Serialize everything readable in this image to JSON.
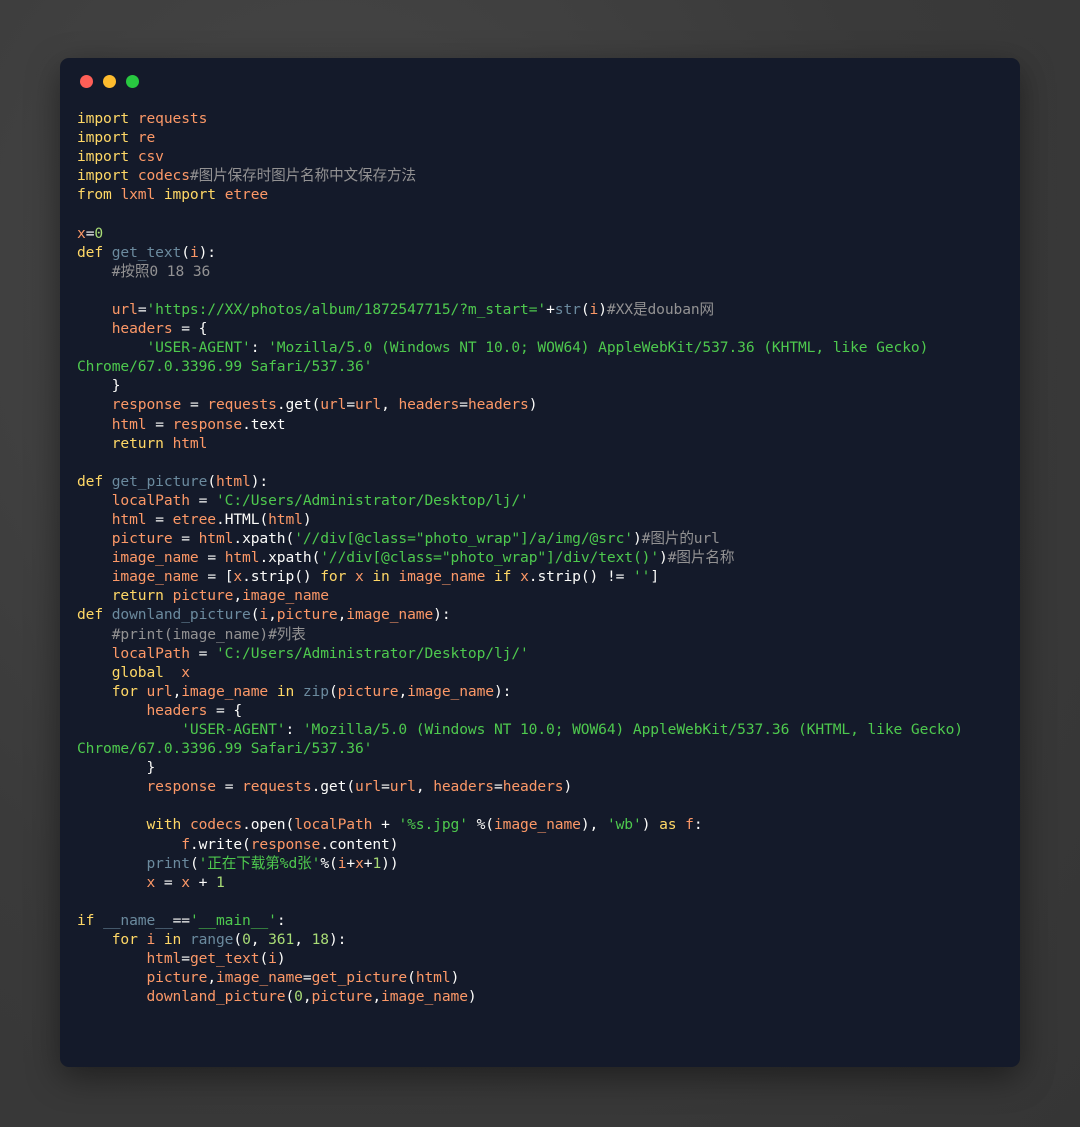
{
  "window": {
    "dots": [
      {
        "name": "close",
        "color": "#ff5f57"
      },
      {
        "name": "minimize",
        "color": "#febc2e"
      },
      {
        "name": "maximize",
        "color": "#28c840"
      }
    ]
  },
  "editor": {
    "language": "python",
    "background": "#141a2a",
    "page_background": "#3c3c3c",
    "palette": {
      "keyword": "#ffd866",
      "function": "#6b8a9e",
      "variable": "#fc9867",
      "string": "#4ec94e",
      "number": "#ab9df2",
      "comment": "#939293",
      "plain": "#fcfcfa"
    },
    "code_lines": [
      "import requests",
      "import re",
      "import csv",
      "import codecs#图片保存时图片名称中文保存方法",
      "from lxml import etree",
      "",
      "x=0",
      "def get_text(i):",
      "    #按照0 18 36",
      "",
      "    url='https://XX/photos/album/1872547715/?m_start='+str(i)#XX是douban网",
      "    headers = {",
      "        'USER-AGENT': 'Mozilla/5.0 (Windows NT 10.0; WOW64) AppleWebKit/537.36 (KHTML, like Gecko) Chrome/67.0.3396.99 Safari/537.36'",
      "    }",
      "    response = requests.get(url=url, headers=headers)",
      "    html = response.text",
      "    return html",
      "",
      "def get_picture(html):",
      "    localPath = 'C:/Users/Administrator/Desktop/lj/'",
      "    html = etree.HTML(html)",
      "    picture = html.xpath('//div[@class=\"photo_wrap\"]/a/img/@src')#图片的url",
      "    image_name = html.xpath('//div[@class=\"photo_wrap\"]/div/text()')#图片名称",
      "    image_name = [x.strip() for x in image_name if x.strip() != '']",
      "    return picture,image_name",
      "def downland_picture(i,picture,image_name):",
      "    #print(image_name)#列表",
      "    localPath = 'C:/Users/Administrator/Desktop/lj/'",
      "    global  x",
      "    for url,image_name in zip(picture,image_name):",
      "        headers = {",
      "            'USER-AGENT': 'Mozilla/5.0 (Windows NT 10.0; WOW64) AppleWebKit/537.36 (KHTML, like Gecko) Chrome/67.0.3396.99 Safari/537.36'",
      "        }",
      "        response = requests.get(url=url, headers=headers)",
      "",
      "        with codecs.open(localPath + '%s.jpg' %(image_name), 'wb') as f:",
      "            f.write(response.content)",
      "        print('正在下载第%d张'%(i+x+1))",
      "        x = x + 1",
      "",
      "if __name__=='__main__':",
      "    for i in range(0, 361, 18):",
      "        html=get_text(i)",
      "        picture,image_name=get_picture(html)",
      "        downland_picture(0,picture,image_name)"
    ]
  }
}
